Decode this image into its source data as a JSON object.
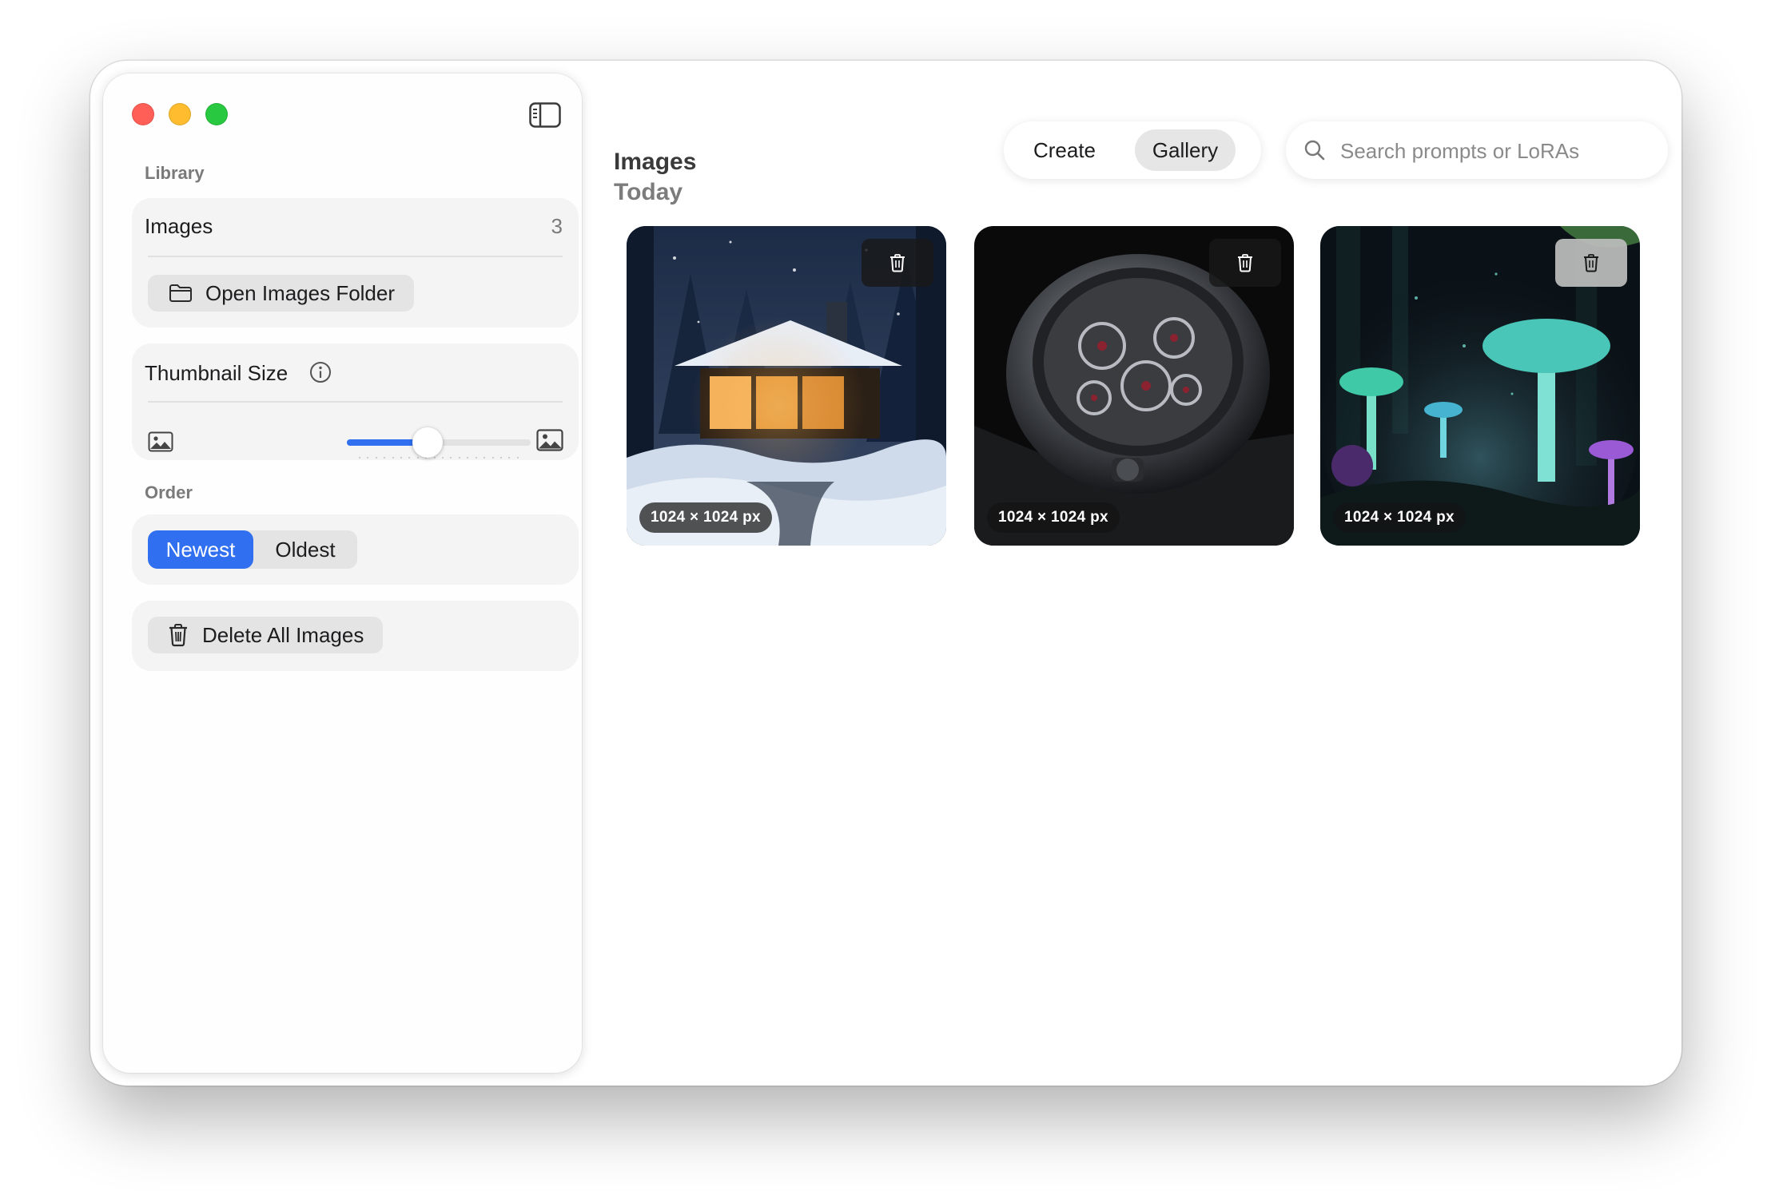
{
  "window": {
    "traffic_lights": {
      "close_color": "#ff5f57",
      "minimize_color": "#febc2e",
      "zoom_color": "#28c840"
    },
    "sidebar_toggle_icon": "sidebar-left-icon"
  },
  "sidebar": {
    "library_label": "Library",
    "images_label": "Images",
    "images_count": "3",
    "open_folder_label": "Open Images Folder",
    "open_folder_icon": "folder-icon",
    "thumbnail_size_label": "Thumbnail Size",
    "thumbnail_info_icon": "info-icon",
    "thumbnail_size_fraction": 0.44,
    "thumbnail_small_icon": "photo-small-icon",
    "thumbnail_large_icon": "photo-large-icon",
    "order_label": "Order",
    "order_options": [
      "Newest",
      "Oldest"
    ],
    "order_selected": "Newest",
    "delete_all_label": "Delete All Images",
    "delete_all_icon": "trash-icon"
  },
  "main": {
    "title": "Images",
    "tabs": [
      {
        "label": "Create",
        "active": false
      },
      {
        "label": "Gallery",
        "active": true
      }
    ],
    "search": {
      "placeholder": "Search prompts or LoRAs",
      "value": ""
    },
    "group_title": "Today",
    "images": [
      {
        "subject": "snowy cabin in forest at night",
        "size_label": "1024 × 1024 px"
      },
      {
        "subject": "skeleton mechanical wristwatch",
        "size_label": "1024 × 1024 px"
      },
      {
        "subject": "bioluminescent mushroom forest",
        "size_label": "1024 × 1024 px"
      }
    ]
  },
  "colors": {
    "accent": "#2f6ff0",
    "sidebar_bg": "#fefefe",
    "card_bg": "#f4f4f4"
  }
}
